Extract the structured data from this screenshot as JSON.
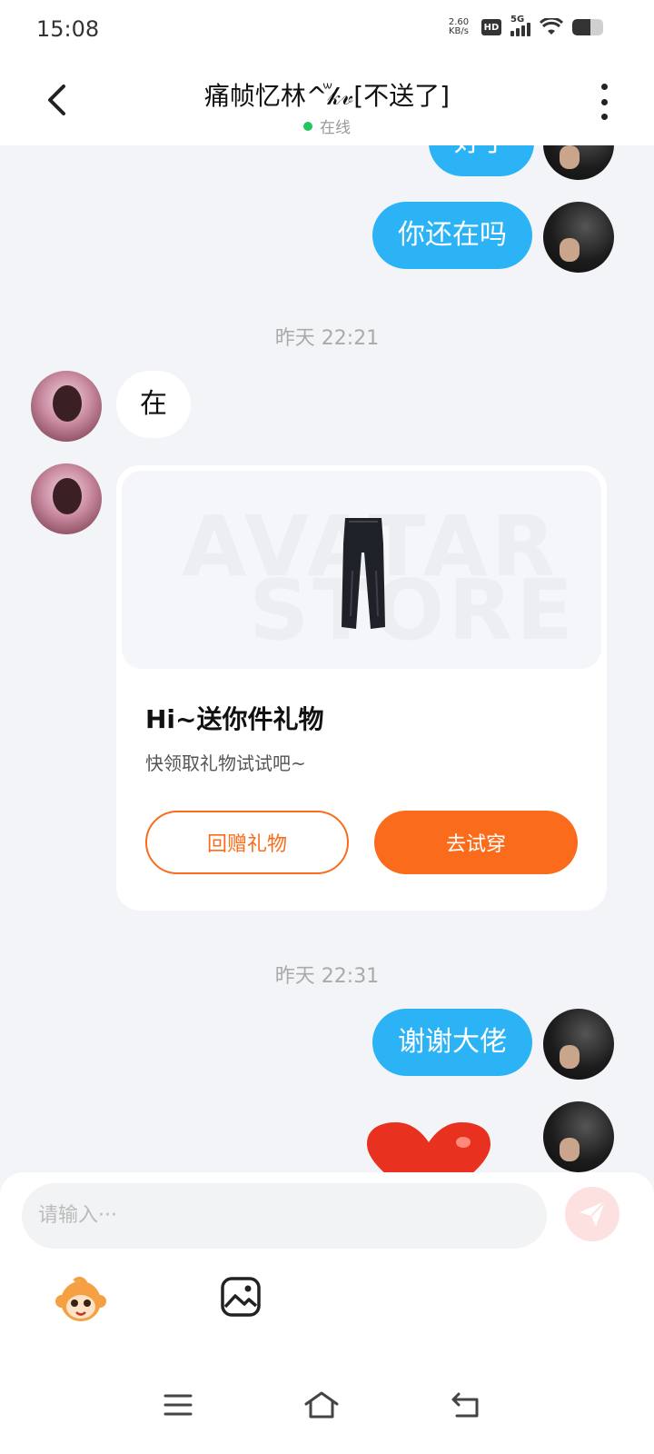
{
  "status_bar": {
    "time": "15:08",
    "net_speed_value": "2.60",
    "net_speed_unit": "KB/s",
    "hd_badge": "HD",
    "network": "5G",
    "battery_level": 0.6
  },
  "header": {
    "title": "痛帧忆林^ꙻ𝓀𝓋[不送了]",
    "status": "在线"
  },
  "messages": {
    "partial_out_text": "好了",
    "out_1": "你还在吗",
    "time_1": "昨天 22:21",
    "in_1": "在",
    "gift_card": {
      "watermark_line1": "AVATAR",
      "watermark_line2": "STORE",
      "title": "Hi~送你件礼物",
      "subtitle": "快领取礼物试试吧~",
      "return_gift_label": "回赠礼物",
      "try_on_label": "去试穿"
    },
    "time_2": "昨天 22:31",
    "out_2": "谢谢大佬"
  },
  "input": {
    "placeholder": "请输入···"
  },
  "colors": {
    "bubble_out": "#2bb3f5",
    "accent_orange": "#fa6c1c",
    "online_green": "#22c55e",
    "background": "#f2f4f7"
  },
  "icons": {
    "back": "chevron-left-icon",
    "more": "more-vertical-icon",
    "send": "send-icon",
    "mascot": "monkey-mascot-icon",
    "image": "image-icon",
    "nav_menu": "menu-icon",
    "nav_home": "home-icon",
    "nav_back": "back-icon"
  }
}
